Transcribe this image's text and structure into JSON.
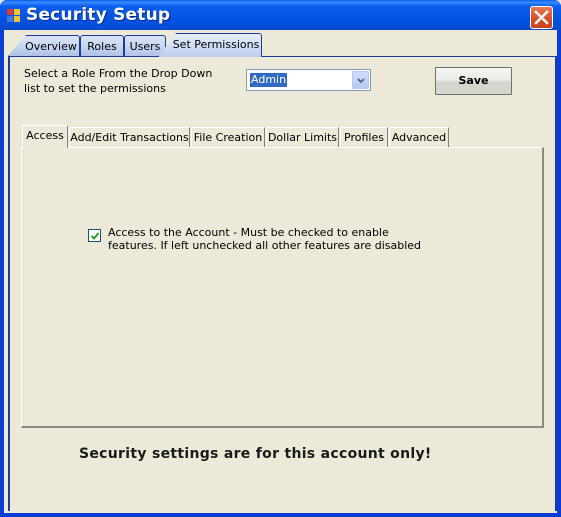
{
  "window": {
    "title": "Security Setup",
    "icon": "app-window-icon",
    "close_icon": "close-icon"
  },
  "top_tabs": [
    {
      "label": "Overview",
      "active": false
    },
    {
      "label": "Roles",
      "active": false
    },
    {
      "label": "Users",
      "active": false
    },
    {
      "label": "Set Permissions",
      "active": true
    }
  ],
  "role_select": {
    "instructions": "Select a Role From the Drop Down list to set the permissions",
    "value": "Admin",
    "arrow_icon": "chevron-down-icon"
  },
  "save_label": "Save",
  "inner_tabs": [
    {
      "label": "Access",
      "active": true
    },
    {
      "label": "Add/Edit Transactions",
      "active": false
    },
    {
      "label": "File Creation",
      "active": false
    },
    {
      "label": "Dollar Limits",
      "active": false
    },
    {
      "label": "Profiles",
      "active": false
    },
    {
      "label": "Advanced",
      "active": false
    }
  ],
  "access": {
    "checked": true,
    "label": "Access to the Account - Must be checked to enable features.  If left unchecked all other features are disabled"
  },
  "footer_note": "Security settings are for this account only!"
}
